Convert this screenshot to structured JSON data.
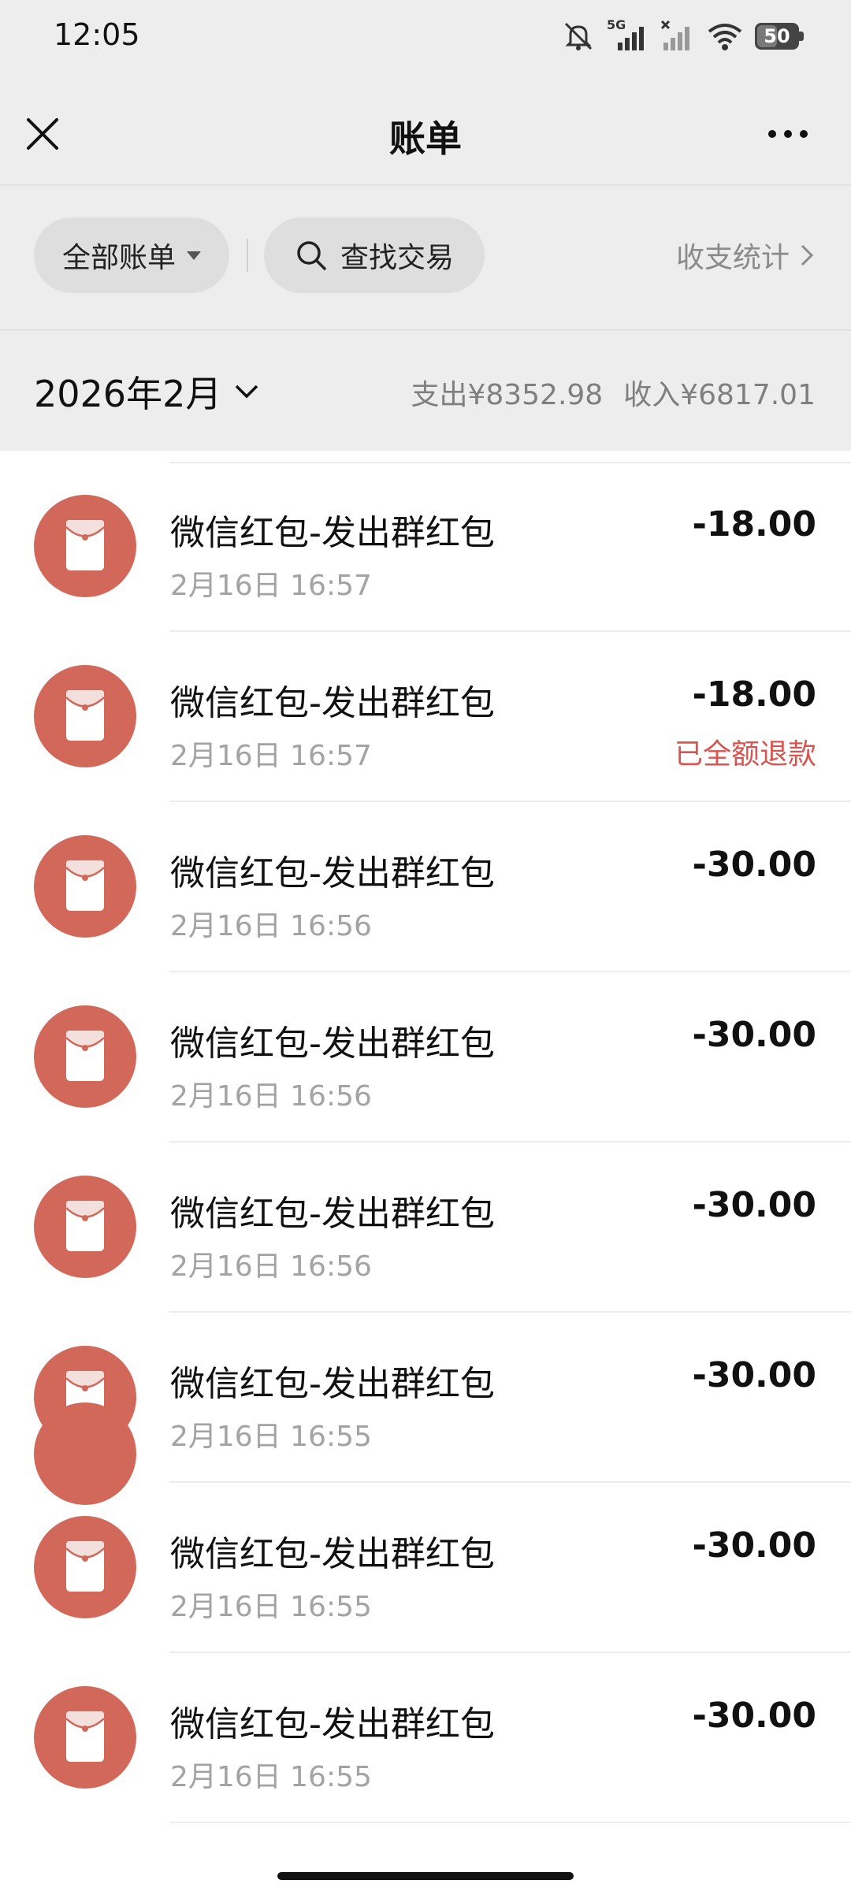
{
  "status_bar": {
    "time": "12:05",
    "network": "5G",
    "battery": "50",
    "battery_level": 0.5,
    "icons": [
      "mute-icon",
      "signal-5g-icon",
      "signal-no-sim-icon",
      "wifi-icon",
      "battery-icon"
    ]
  },
  "nav": {
    "title": "账单",
    "close_icon": "close-icon",
    "more_icon": "more-icon"
  },
  "filters": {
    "all_bills": "全部账单",
    "search": "查找交易",
    "stats": "收支统计"
  },
  "month": {
    "label": "2026年2月",
    "expense": "支出¥8352.98",
    "income": "收入¥6817.01"
  },
  "colors": {
    "background": "#ededed",
    "red_packet": "#d2685a",
    "refund_text": "#d9534f"
  },
  "transactions": [
    {
      "title": "微信红包-发出群红包",
      "time": "2月16日 16:57",
      "amount": "-18.00",
      "status": ""
    },
    {
      "title": "微信红包-发出群红包",
      "time": "2月16日 16:57",
      "amount": "-18.00",
      "status": "已全额退款"
    },
    {
      "title": "微信红包-发出群红包",
      "time": "2月16日 16:56",
      "amount": "-30.00",
      "status": ""
    },
    {
      "title": "微信红包-发出群红包",
      "time": "2月16日 16:56",
      "amount": "-30.00",
      "status": ""
    },
    {
      "title": "微信红包-发出群红包",
      "time": "2月16日 16:56",
      "amount": "-30.00",
      "status": ""
    },
    {
      "title": "微信红包-发出群红包",
      "time": "2月16日 16:55",
      "amount": "-30.00",
      "status": ""
    },
    {
      "title": "微信红包-发出群红包",
      "time": "2月16日 16:55",
      "amount": "-30.00",
      "status": ""
    },
    {
      "title": "微信红包-发出群红包",
      "time": "2月16日 16:55",
      "amount": "-30.00",
      "status": ""
    }
  ]
}
